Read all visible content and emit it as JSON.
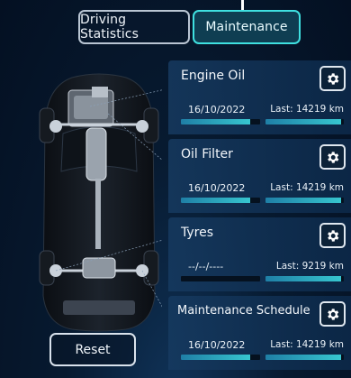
{
  "tabs": [
    {
      "label": "Driving Statistics",
      "active": false
    },
    {
      "label": "Maintenance",
      "active": true
    }
  ],
  "items": [
    {
      "title": "Engine Oil",
      "date": "16/10/2022",
      "last": "Last: 14219  km",
      "progress_left": 0.88,
      "progress_right": 0.97,
      "icon": "gear-icon"
    },
    {
      "title": "Oil Filter",
      "date": "16/10/2022",
      "last": "Last: 14219  km",
      "progress_left": 0.88,
      "progress_right": 0.97,
      "icon": "gear-icon"
    },
    {
      "title": "Tyres",
      "date": "--/--/----",
      "last": "Last: 9219  km",
      "progress_left": 0.0,
      "progress_right": 0.97,
      "icon": "gear-icon"
    },
    {
      "title": "Maintenance Schedule",
      "date": "16/10/2022",
      "last": "Last: 14219  km",
      "progress_left": 0.88,
      "progress_right": 0.97,
      "icon": "gear-icon"
    }
  ],
  "reset_label": "Reset",
  "colors": {
    "accent": "#3fe0e0",
    "bar_fill": "#37c6cf",
    "card_bg": "#163a60",
    "background": "#071a30"
  }
}
